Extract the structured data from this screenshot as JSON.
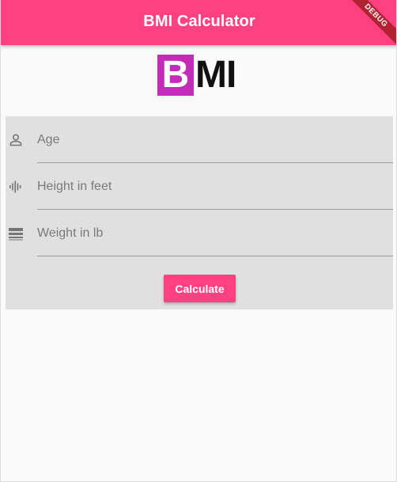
{
  "app": {
    "title": "BMI Calculator",
    "debug_banner": "DEBUG",
    "accent_color": "#ff4081"
  },
  "logo": {
    "letter_b": "B",
    "letters_rest": "MI",
    "b_background": "#c42bb8"
  },
  "form": {
    "fields": [
      {
        "placeholder": "Age",
        "icon": "person-outline-icon"
      },
      {
        "placeholder": "Height in feet",
        "icon": "graphic-eq-icon"
      },
      {
        "placeholder": "Weight in lb",
        "icon": "line-weight-icon"
      }
    ],
    "calculate_label": "Calculate"
  }
}
